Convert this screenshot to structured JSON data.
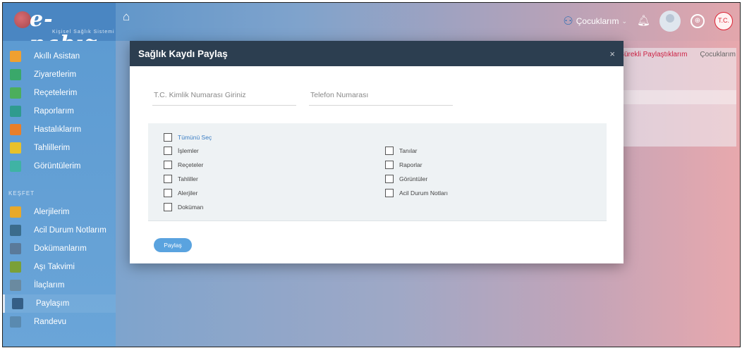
{
  "brand": {
    "name": "e-nabız",
    "subtitle": "Kişisel Sağlık Sistemi"
  },
  "header": {
    "children_label": "Çocuklarım",
    "ministry_badge": "T.C."
  },
  "sidebar": {
    "items": [
      {
        "label": "Akıllı Asistan",
        "icon": "assistant-icon",
        "color": "#f0a030"
      },
      {
        "label": "Ziyaretlerim",
        "icon": "hospital-icon",
        "color": "#3aa86a"
      },
      {
        "label": "Reçetelerim",
        "icon": "prescription-icon",
        "color": "#4cae5c"
      },
      {
        "label": "Raporlarım",
        "icon": "report-icon",
        "color": "#2f9b8f"
      },
      {
        "label": "Hastalıklarım",
        "icon": "illness-icon",
        "color": "#e87f2a"
      },
      {
        "label": "Tahlillerim",
        "icon": "lab-icon",
        "color": "#e8c12a"
      },
      {
        "label": "Görüntülerim",
        "icon": "imaging-icon",
        "color": "#3fb3a4"
      }
    ],
    "section_label": "KEŞFET",
    "explore": [
      {
        "label": "Alerjilerim",
        "icon": "allergy-icon",
        "color": "#e8a92a"
      },
      {
        "label": "Acil Durum Notlarım",
        "icon": "emergency-note-icon",
        "color": "#3b6c8c"
      },
      {
        "label": "Dokümanlarım",
        "icon": "document-icon",
        "color": "#5a7a9a"
      },
      {
        "label": "Aşı Takvimi",
        "icon": "vaccine-icon",
        "color": "#7aa038"
      },
      {
        "label": "İlaçlarım",
        "icon": "medicine-icon",
        "color": "#6a8aa0"
      },
      {
        "label": "Paylaşım",
        "icon": "share-icon",
        "color": "#345e86"
      },
      {
        "label": "Randevu",
        "icon": "appointment-icon",
        "color": "#5a8ab0"
      }
    ]
  },
  "background": {
    "tabs": [
      "Sürekli Paylaştıklarım",
      "Çocuklarım"
    ]
  },
  "modal": {
    "title": "Sağlık Kaydı Paylaş",
    "close_label": "×",
    "tc_placeholder": "T.C. Kimlik Numarası Giriniz",
    "phone_placeholder": "Telefon Numarası",
    "select_all": "Tümünü Seç",
    "left_options": [
      "İşlemler",
      "Reçeteler",
      "Tahliller",
      "Alerjiler",
      "Doküman"
    ],
    "right_options": [
      "Tanılar",
      "Raporlar",
      "Görüntüler",
      "Acil Durum Notları"
    ],
    "share_button": "Paylaş"
  }
}
